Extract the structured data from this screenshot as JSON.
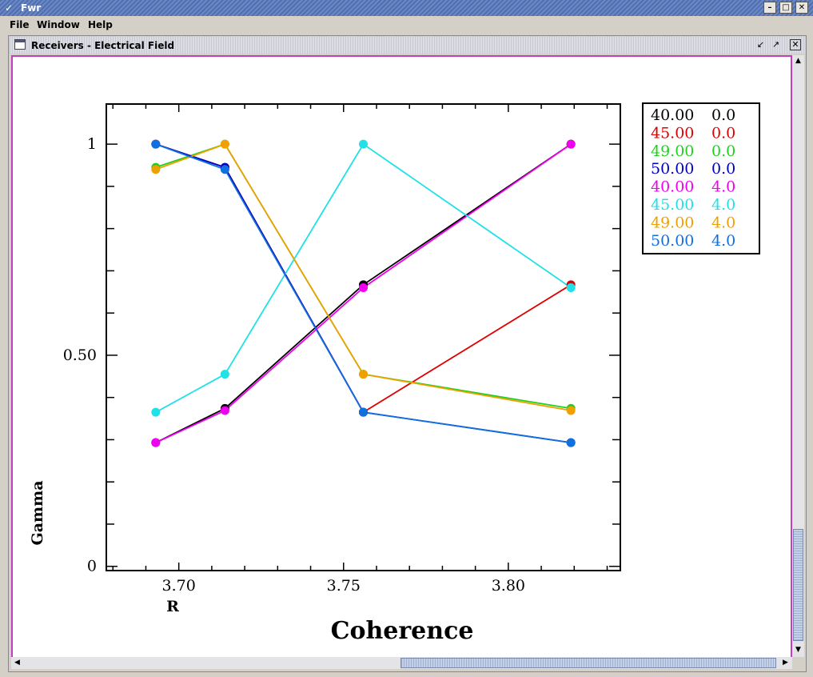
{
  "app": {
    "title": "Fwr"
  },
  "menu": [
    "File",
    "Window",
    "Help"
  ],
  "window": {
    "title": "Receivers - Electrical Field"
  },
  "chart_data": {
    "type": "line",
    "xlabel": "Coherence",
    "ylabel": "Gamma",
    "x_unit_label": "R",
    "xlim": [
      3.678,
      3.834
    ],
    "ylim": [
      -0.01,
      1.095
    ],
    "xticks": [
      3.7,
      3.75,
      3.8
    ],
    "xtick_labels": [
      "3.70",
      "3.75",
      "3.80"
    ],
    "yticks": [
      0,
      0.5,
      1
    ],
    "ytick_labels": [
      "0",
      "0.50",
      "1"
    ],
    "x": [
      3.693,
      3.714,
      3.756,
      3.819
    ],
    "legend_position": "top-right outside",
    "series": [
      {
        "name": "40.00  0.0",
        "name_a": "40.00",
        "name_b": "0.0",
        "color": "#000000",
        "values": [
          0.293,
          0.374,
          0.667,
          1.0
        ]
      },
      {
        "name": "45.00  0.0",
        "name_a": "45.00",
        "name_b": "0.0",
        "color": "#e00000",
        "values": [
          1.0,
          0.945,
          0.365,
          0.667
        ]
      },
      {
        "name": "49.00  0.0",
        "name_a": "49.00",
        "name_b": "0.0",
        "color": "#20d020",
        "values": [
          0.945,
          1.0,
          0.455,
          0.374
        ]
      },
      {
        "name": "50.00  0.0",
        "name_a": "50.00",
        "name_b": "0.0",
        "color": "#0000c0",
        "values": [
          1.0,
          0.945,
          0.365,
          0.293
        ]
      },
      {
        "name": "40.00  4.0",
        "name_a": "40.00",
        "name_b": "4.0",
        "color": "#f000f0",
        "values": [
          0.293,
          0.369,
          0.66,
          1.0
        ]
      },
      {
        "name": "45.00  4.0",
        "name_a": "45.00",
        "name_b": "4.0",
        "color": "#20e0e8",
        "values": [
          0.365,
          0.455,
          1.0,
          0.66
        ]
      },
      {
        "name": "49.00  4.0",
        "name_a": "49.00",
        "name_b": "4.0",
        "color": "#f0a000",
        "values": [
          0.94,
          1.0,
          0.455,
          0.369
        ]
      },
      {
        "name": "50.00  4.0",
        "name_a": "50.00",
        "name_b": "4.0",
        "color": "#1070e0",
        "values": [
          1.0,
          0.94,
          0.365,
          0.293
        ]
      }
    ]
  }
}
